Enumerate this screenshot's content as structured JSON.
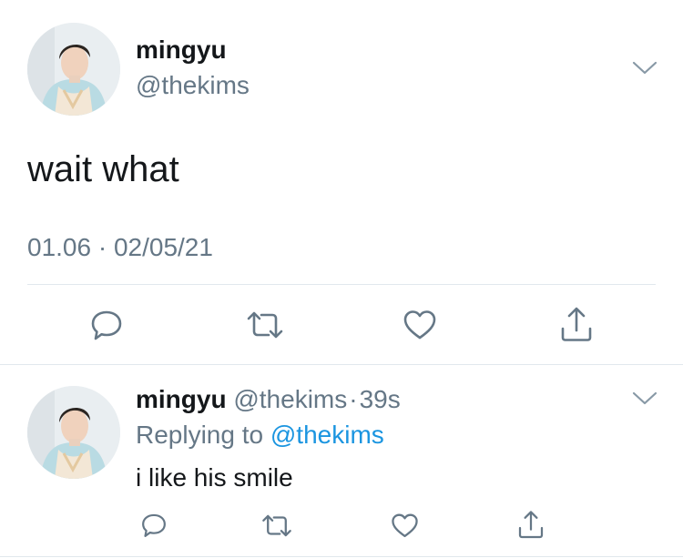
{
  "colors": {
    "text": "#14171a",
    "muted": "#657786",
    "link": "#1b95e0",
    "icon": "#657786",
    "divider": "#e1e8ed"
  },
  "main_tweet": {
    "display_name": "mingyu",
    "handle": "@thekims",
    "text": "wait what",
    "timestamp": "01.06 · 02/05/21",
    "actions": [
      "reply-icon",
      "retweet-icon",
      "like-icon",
      "share-icon"
    ]
  },
  "reply_tweet": {
    "display_name": "mingyu",
    "handle": "@thekims",
    "separator": "·",
    "time": "39s",
    "replying_label": "Replying to",
    "replying_to": "@thekims",
    "text": "i like his smile",
    "actions": [
      "reply-icon",
      "retweet-icon",
      "like-icon",
      "share-icon"
    ]
  }
}
